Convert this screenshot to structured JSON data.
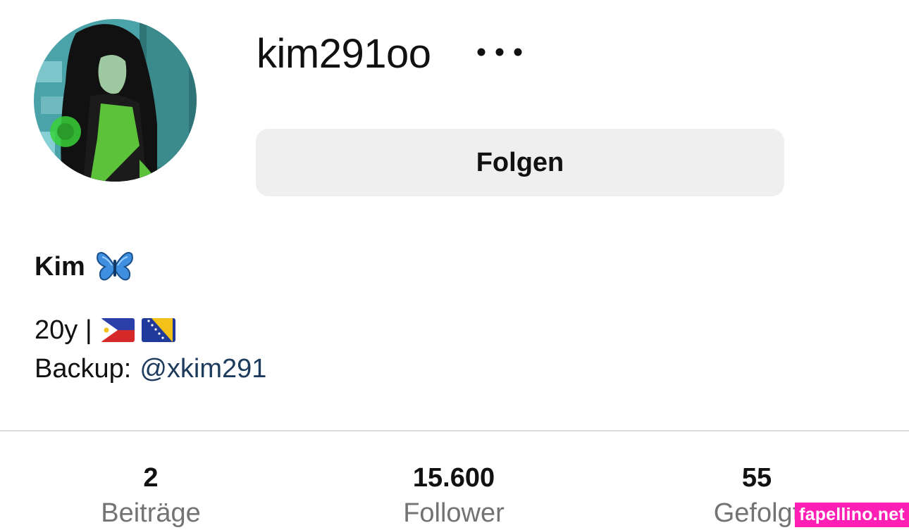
{
  "profile": {
    "username": "kim291oo",
    "follow_label": "Folgen",
    "display_name": "Kim",
    "bio_line1": "20y |",
    "bio_backup_label": "Backup:",
    "bio_backup_handle": "@xkim291"
  },
  "stats": [
    {
      "value": "2",
      "label": "Beiträge"
    },
    {
      "value": "15.600",
      "label": "Follower"
    },
    {
      "value": "55",
      "label": "Gefolgt"
    }
  ],
  "icons": {
    "more": "more-horizontal-icon",
    "butterfly": "butterfly-emoji",
    "flags": [
      "philippines-flag",
      "bosnia-flag"
    ]
  },
  "colors": {
    "follow_button_bg": "#efefef",
    "link": "#1d3b5c",
    "label_gray": "#737373",
    "watermark_bg": "#ff1fb4"
  },
  "watermark": "fapellino.net"
}
